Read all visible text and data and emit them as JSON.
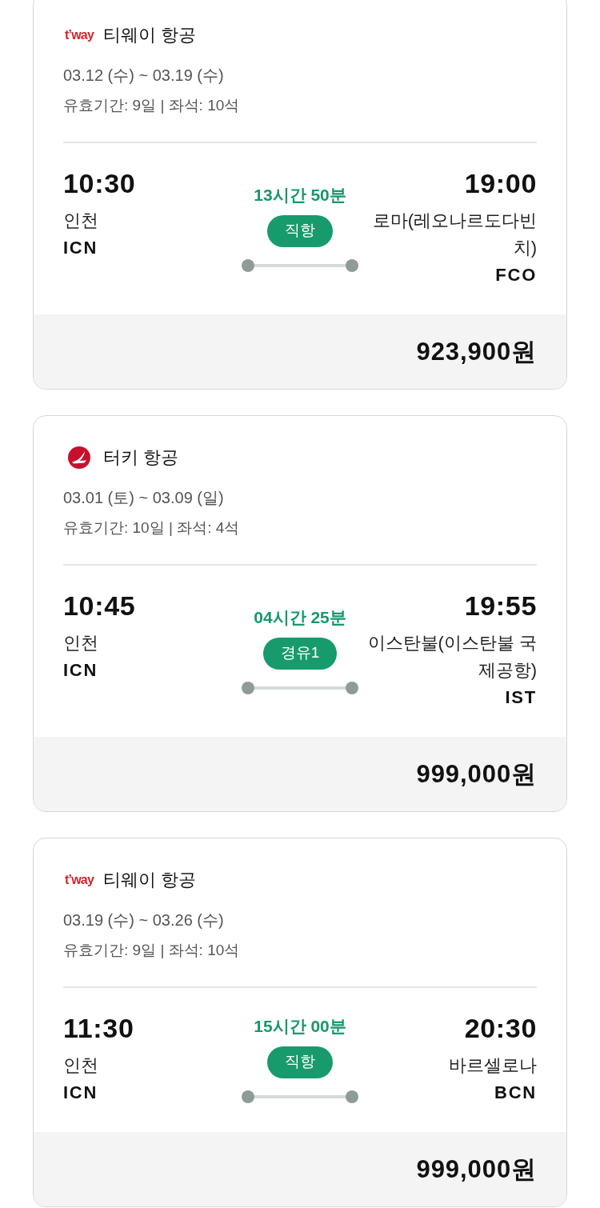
{
  "flights": [
    {
      "airline": {
        "logo": {
          "kind": "wordmark",
          "text": "t’way"
        },
        "name": "티웨이 항공"
      },
      "dates": "03.12 (수) ~ 03.19 (수)",
      "validity": "유효기간: 9일 | 좌석: 10석",
      "departure": {
        "time": "10:30",
        "city": "인천",
        "code": "ICN"
      },
      "duration": "13시간 50분",
      "route_type": "직항",
      "arrival": {
        "time": "19:00",
        "city": "로마(레오나르도다빈치)",
        "code": "FCO"
      },
      "price": "923,900원"
    },
    {
      "airline": {
        "logo": {
          "kind": "emblem"
        },
        "name": "터키 항공"
      },
      "dates": "03.01 (토) ~ 03.09 (일)",
      "validity": "유효기간: 10일 | 좌석: 4석",
      "departure": {
        "time": "10:45",
        "city": "인천",
        "code": "ICN"
      },
      "duration": "04시간 25분",
      "route_type": "경유1",
      "arrival": {
        "time": "19:55",
        "city": "이스탄불(이스탄불 국제공항)",
        "code": "IST"
      },
      "price": "999,000원"
    },
    {
      "airline": {
        "logo": {
          "kind": "wordmark",
          "text": "t’way"
        },
        "name": "티웨이 항공"
      },
      "dates": "03.19 (수) ~ 03.26 (수)",
      "validity": "유효기간: 9일 | 좌석: 10석",
      "departure": {
        "time": "11:30",
        "city": "인천",
        "code": "ICN"
      },
      "duration": "15시간 00분",
      "route_type": "직항",
      "arrival": {
        "time": "20:30",
        "city": "바르셀로나",
        "code": "BCN"
      },
      "price": "999,000원"
    }
  ]
}
